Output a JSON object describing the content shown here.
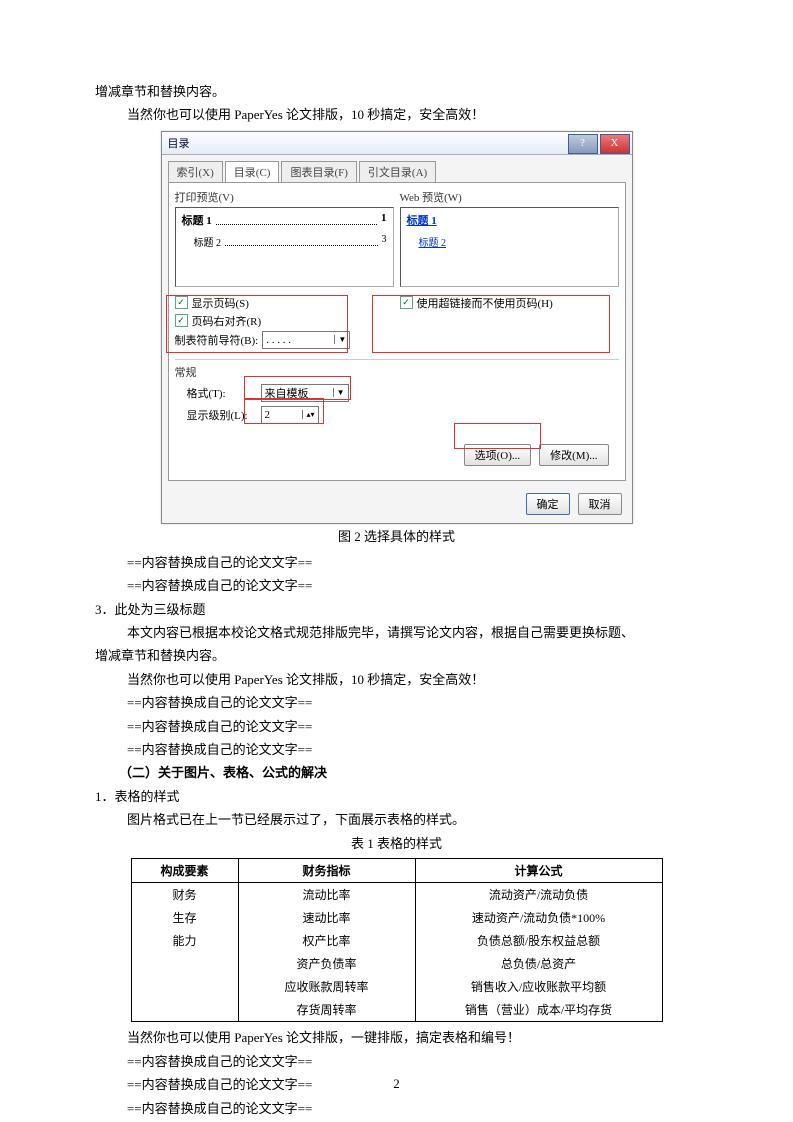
{
  "body": {
    "line1": "增减章节和替换内容。",
    "line2": "当然你也可以使用 PaperYes 论文排版，10 秒搞定，安全高效！",
    "fig_caption": "图 2 选择具体的样式",
    "replace1": "==内容替换成自己的论文文字==",
    "replace2": "==内容替换成自己的论文文字==",
    "h3num": "3．",
    "h3title": "此处为三级标题",
    "para3a": "本文内容已根据本校论文格式规范排版完毕，请撰写论文内容，根据自己需要更换标题、",
    "para3b": "增减章节和替换内容。",
    "para4": "当然你也可以使用 PaperYes 论文排版，10 秒搞定，安全高效！",
    "replace3": "==内容替换成自己的论文文字==",
    "replace4": "==内容替换成自己的论文文字==",
    "replace5": "==内容替换成自己的论文文字==",
    "h2": "（二）关于图片、表格、公式的解决",
    "s1num": "1．",
    "s1title": "表格的样式",
    "para5": "图片格式已在上一节已经展示过了，下面展示表格的样式。",
    "tbl_caption": "表 1 表格的样式",
    "para6": "当然你也可以使用 PaperYes 论文排版，一键排版，搞定表格和编号！",
    "replace6": "==内容替换成自己的论文文字==",
    "replace7": "==内容替换成自己的论文文字==",
    "replace8": "==内容替换成自己的论文文字==",
    "pagenum": "2"
  },
  "dialog": {
    "title": "目录",
    "help": "?",
    "close": "X",
    "tab_index": "索引(X)",
    "tab_toc": "目录(C)",
    "tab_fig": "图表目录(F)",
    "tab_cite": "引文目录(A)",
    "left_label": "打印预览(V)",
    "right_label": "Web 预览(W)",
    "toc1_text": "标题 1",
    "toc1_page": "1",
    "toc2_text": "标题 2",
    "toc2_page": "3",
    "web1": "标题 1",
    "web2": "标题 2",
    "chk_page": "显示页码(S)",
    "chk_align": "页码右对齐(R)",
    "chk_link": "使用超链接而不使用页码(H)",
    "tab_leader_lbl": "制表符前导符(B):",
    "tab_leader_val": ". . . . .",
    "general": "常规",
    "format_lbl": "格式(T):",
    "format_val": "来自模板",
    "levels_lbl": "显示级别(L):",
    "levels_val": "2",
    "btn_options": "选项(O)...",
    "btn_modify": "修改(M)...",
    "btn_ok": "确定",
    "btn_cancel": "取消"
  },
  "table": {
    "h1": "构成要素",
    "h2": "财务指标",
    "h3": "计算公式",
    "r1c1": "财务",
    "r1c2": "流动比率",
    "r1c3": "流动资产/流动负债",
    "r2c1": "生存",
    "r2c2": "速动比率",
    "r2c3": "速动资产/流动负债*100%",
    "r3c1": "能力",
    "r3c2": "权产比率",
    "r3c3": "负债总额/股东权益总额",
    "r4c2": "资产负债率",
    "r4c3": "总负债/总资产",
    "r5c2": "应收账款周转率",
    "r5c3": "销售收入/应收账款平均额",
    "r6c2": "存货周转率",
    "r6c3": "销售（营业）成本/平均存货"
  }
}
